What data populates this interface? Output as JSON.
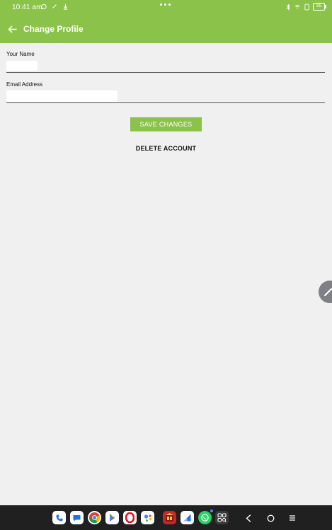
{
  "status_bar": {
    "time": "10:41 am",
    "battery": "85"
  },
  "app_bar": {
    "title": "Change Profile"
  },
  "form": {
    "name_label": "Your Name",
    "name_value": "",
    "email_label": "Email Address",
    "email_value": "",
    "save_label": "SAVE CHANGES",
    "delete_label": "DELETE ACCOUNT"
  },
  "colors": {
    "accent": "#8bc34a",
    "background": "#f0f0f0",
    "taskbar": "#202020"
  },
  "taskbar": {
    "apps": [
      "phone-icon",
      "messages-icon",
      "chrome-icon",
      "play-store-icon",
      "opera-icon",
      "assistant-icon",
      "app-red-icon",
      "files-icon",
      "whatsapp-icon",
      "app-grid-icon"
    ],
    "nav": [
      "back-nav-icon",
      "home-nav-icon",
      "recents-nav-icon"
    ]
  }
}
